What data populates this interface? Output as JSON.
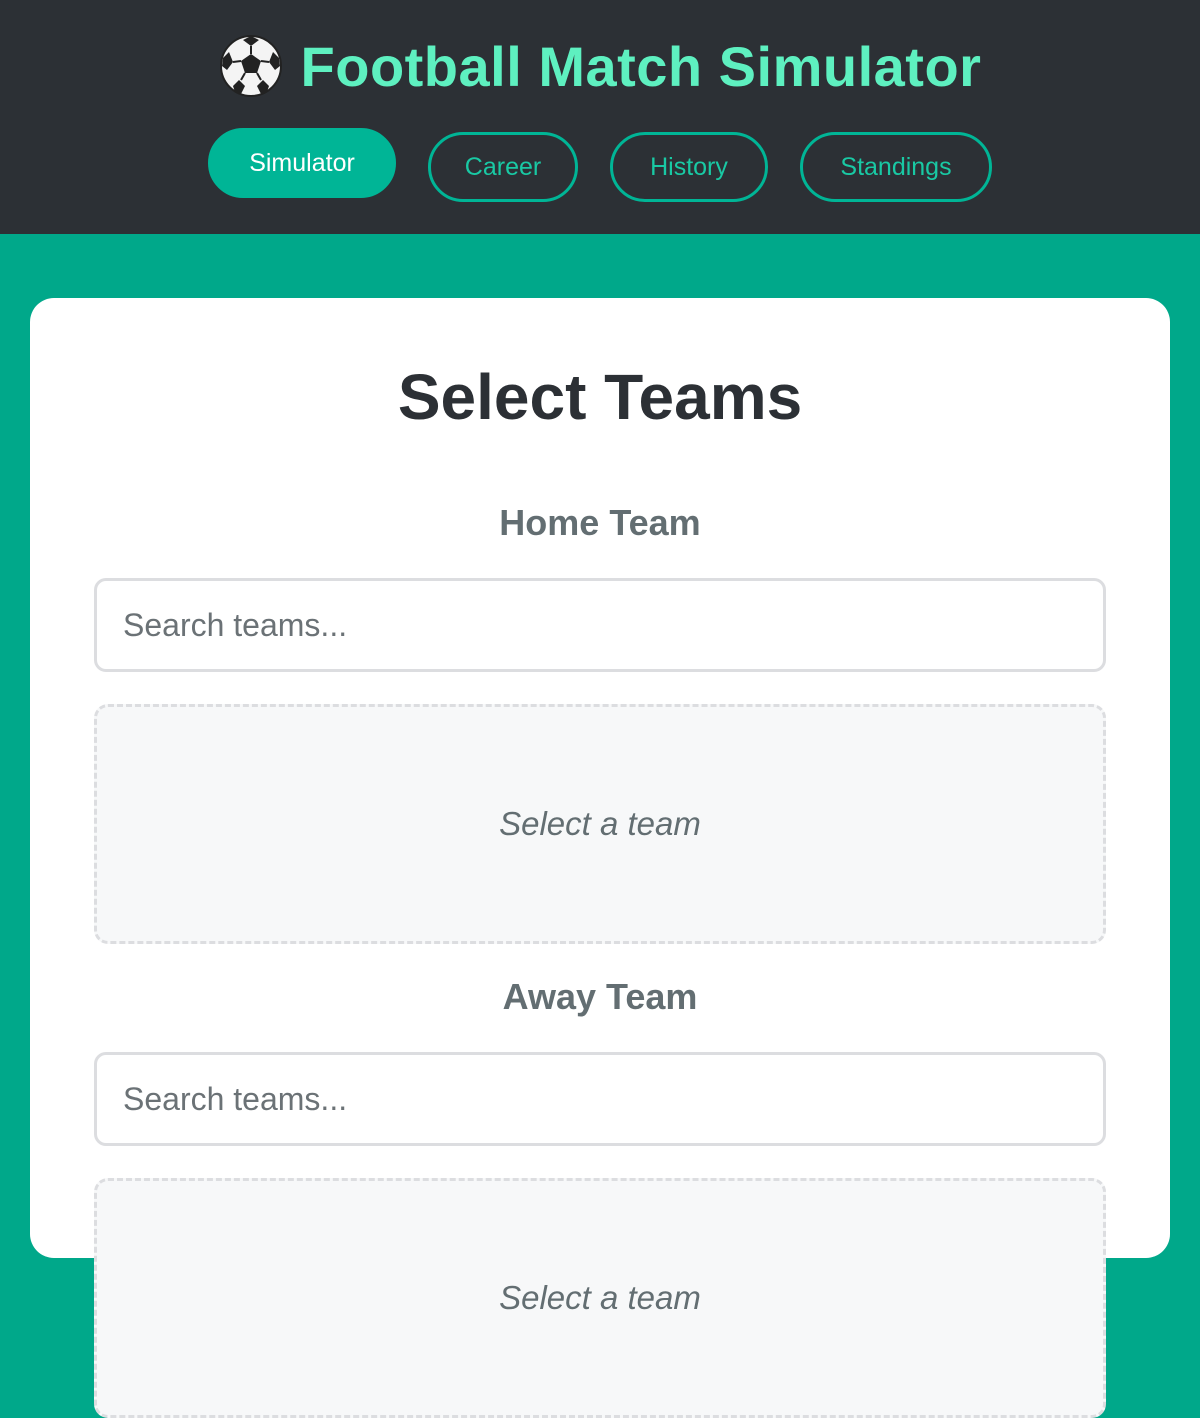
{
  "header": {
    "title": "Football Match Simulator",
    "logo_icon": "soccer-ball-icon",
    "title_color": "#5ef0c0",
    "background": "#2c3035"
  },
  "nav": {
    "tabs": [
      {
        "label": "Simulator",
        "active": true
      },
      {
        "label": "Career",
        "active": false
      },
      {
        "label": "History",
        "active": false
      },
      {
        "label": "Standings",
        "active": false
      }
    ],
    "accent": "#00b596"
  },
  "main": {
    "title": "Select Teams",
    "home": {
      "label": "Home Team",
      "search_placeholder": "Search teams...",
      "slot_text": "Select a team"
    },
    "away": {
      "label": "Away Team",
      "search_placeholder": "Search teams...",
      "slot_text": "Select a team"
    }
  },
  "colors": {
    "page_background": "#00a88a",
    "card_background": "#ffffff"
  }
}
